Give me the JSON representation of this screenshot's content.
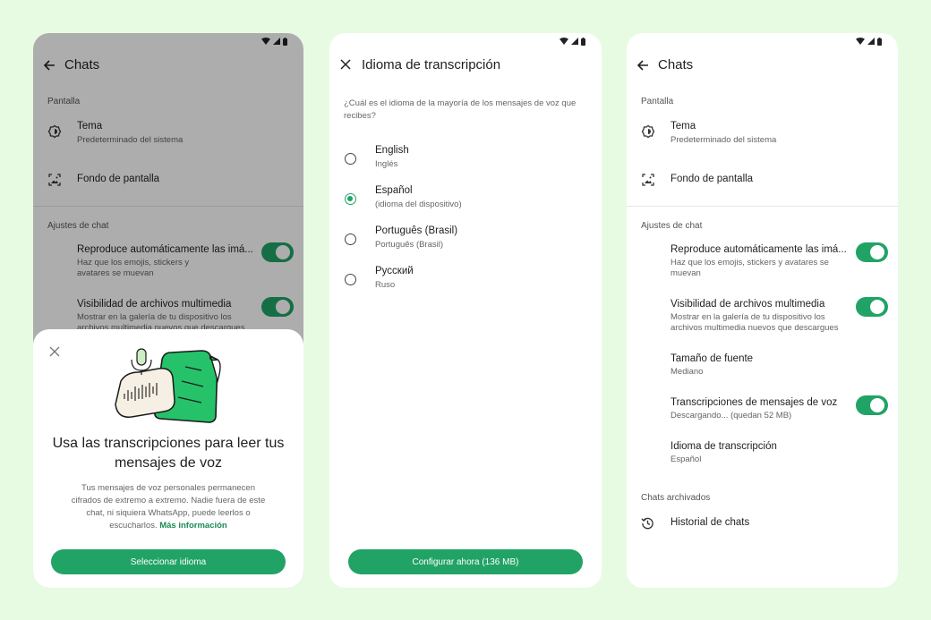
{
  "colors": {
    "background": "#e7fbe3",
    "accent": "#21a366",
    "link": "#1a8a55"
  },
  "status_icons": [
    "wifi-icon",
    "signal-icon",
    "battery-icon"
  ],
  "screen1": {
    "title": "Chats",
    "nav_icon": "back-arrow-icon",
    "sections": {
      "display": "Pantalla",
      "chat_settings": "Ajustes de chat"
    },
    "items": {
      "theme": {
        "title": "Tema",
        "subtitle": "Predeterminado del sistema",
        "icon": "theme-icon"
      },
      "wallpaper": {
        "title": "Fondo de pantalla",
        "icon": "wallpaper-icon"
      },
      "autoplay": {
        "title": "Reproduce automáticamente las imá...",
        "subtitle": "Haz que los emojis, stickers y avatares se muevan",
        "enabled": true
      },
      "media_visibility": {
        "title": "Visibilidad de archivos multimedia",
        "subtitle": "Mostrar en la galería de tu dispositivo los archivos multimedia nuevos que descargues",
        "enabled": true
      }
    },
    "sheet": {
      "close_icon": "close-icon",
      "illustration": "voice-transcription-illustration",
      "headline": "Usa las transcripciones para leer tus mensajes de voz",
      "body": "Tus mensajes de voz personales permanecen cifrados de extremo a extremo. Nadie fuera de este chat, ni siquiera WhatsApp, puede leerlos o escucharlos.",
      "link": "Más información",
      "button": "Seleccionar idioma"
    }
  },
  "screen2": {
    "title": "Idioma de transcripción",
    "nav_icon": "close-icon",
    "question": "¿Cuál es el idioma de la mayoría de los mensajes de voz que recibes?",
    "options": [
      {
        "label": "English",
        "sublabel": "Inglés",
        "selected": false
      },
      {
        "label": "Español",
        "sublabel": "(idioma del dispositivo)",
        "selected": true
      },
      {
        "label": "Português (Brasil)",
        "sublabel": "Português (Brasil)",
        "selected": false
      },
      {
        "label": "Русский",
        "sublabel": "Ruso",
        "selected": false
      }
    ],
    "button": "Configurar ahora (136 MB)"
  },
  "screen3": {
    "title": "Chats",
    "nav_icon": "back-arrow-icon",
    "sections": {
      "display": "Pantalla",
      "chat_settings": "Ajustes de chat",
      "archived": "Chats archivados"
    },
    "items": {
      "theme": {
        "title": "Tema",
        "subtitle": "Predeterminado del sistema"
      },
      "wallpaper": {
        "title": "Fondo de pantalla"
      },
      "autoplay": {
        "title": "Reproduce automáticamente las imá...",
        "subtitle": "Haz que los emojis, stickers y avatares se muevan",
        "enabled": true
      },
      "media_visibility": {
        "title": "Visibilidad de archivos multimedia",
        "subtitle": "Mostrar en la galería de tu dispositivo los archivos multimedia nuevos que descargues",
        "enabled": true
      },
      "font_size": {
        "title": "Tamaño de fuente",
        "subtitle": "Mediano"
      },
      "voice_transcripts": {
        "title": "Transcripciones de mensajes de voz",
        "subtitle": "Descargando... (quedan 52 MB)",
        "enabled": true
      },
      "transcription_language": {
        "title": "Idioma de transcripción",
        "subtitle": "Español"
      },
      "chat_history": {
        "title": "Historial de chats",
        "icon": "history-icon"
      }
    }
  }
}
